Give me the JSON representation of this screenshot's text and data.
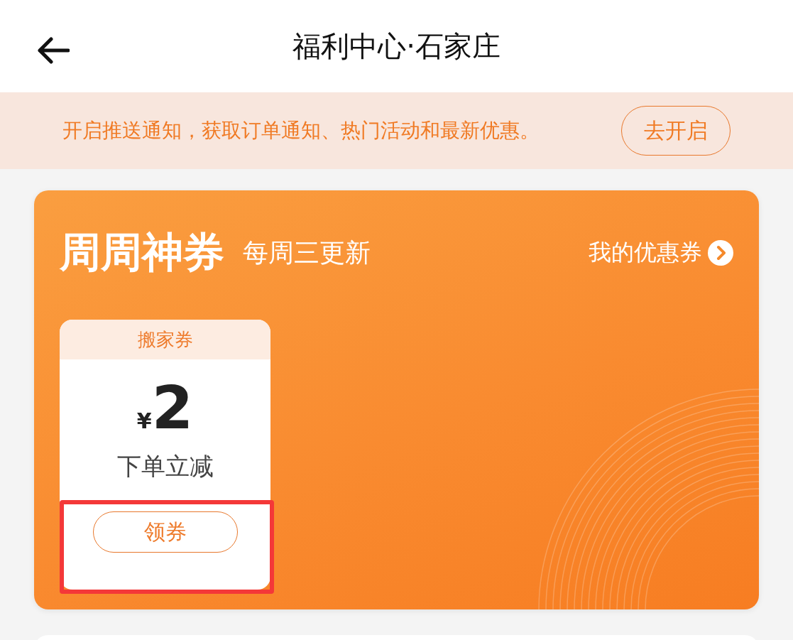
{
  "header": {
    "title": "福利中心·石家庄"
  },
  "notice": {
    "text": "开启推送通知，获取订单通知、热门活动和最新优惠。",
    "button": "去开启"
  },
  "promo": {
    "title": "周周神券",
    "subtitle": "每周三更新",
    "link": "我的优惠券",
    "coupons": [
      {
        "type_label": "搬家券",
        "currency": "¥",
        "amount": "2",
        "description": "下单立减",
        "button": "领券",
        "highlighted": true
      }
    ]
  }
}
